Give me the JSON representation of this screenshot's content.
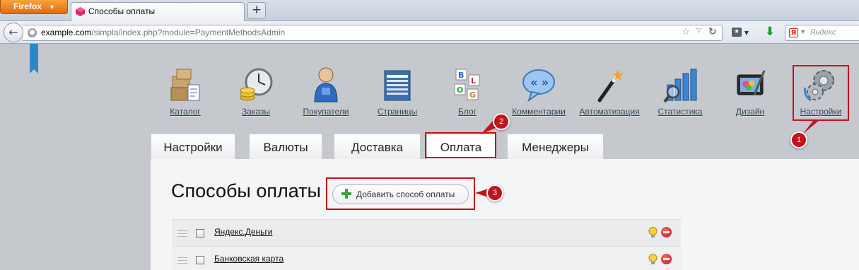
{
  "browser": {
    "app_button": "Firefox",
    "tab_title": "Способы оплаты",
    "new_tab": "+",
    "url_domain": "example.com",
    "url_path": "/simpla/index.php?module=PaymentMethodsAdmin",
    "search_engine_logo": "Я",
    "search_placeholder": "Яндекс"
  },
  "main_menu": [
    {
      "label": "Каталог",
      "icon": "catalog-boxes-icon"
    },
    {
      "label": "Заказы",
      "icon": "orders-clock-icon"
    },
    {
      "label": "Покупатели",
      "icon": "customer-icon"
    },
    {
      "label": "Страницы",
      "icon": "pages-icon"
    },
    {
      "label": "Блог",
      "icon": "blog-blocks-icon"
    },
    {
      "label": "Комментарии",
      "icon": "comments-icon"
    },
    {
      "label": "Автоматизация",
      "icon": "magic-wand-icon"
    },
    {
      "label": "Статистика",
      "icon": "statistics-icon"
    },
    {
      "label": "Дизайн",
      "icon": "design-icon"
    },
    {
      "label": "Настройки",
      "icon": "settings-gears-icon"
    }
  ],
  "sub_tabs": [
    "Настройки",
    "Валюты",
    "Доставка",
    "Оплата",
    "Менеджеры"
  ],
  "active_sub_tab": "Оплата",
  "page": {
    "title": "Способы оплаты",
    "add_button": "Добавить способ оплаты"
  },
  "payment_methods": [
    {
      "name": "Яндекс.Деньги"
    },
    {
      "name": "Банковская карта"
    }
  ],
  "annotations": [
    "1",
    "2",
    "3"
  ],
  "colors": {
    "annotation_red": "#c3131c",
    "firefox_orange": "#e46b0c",
    "link_blue": "#2d3f55",
    "background_gray": "#c5c8cc"
  }
}
